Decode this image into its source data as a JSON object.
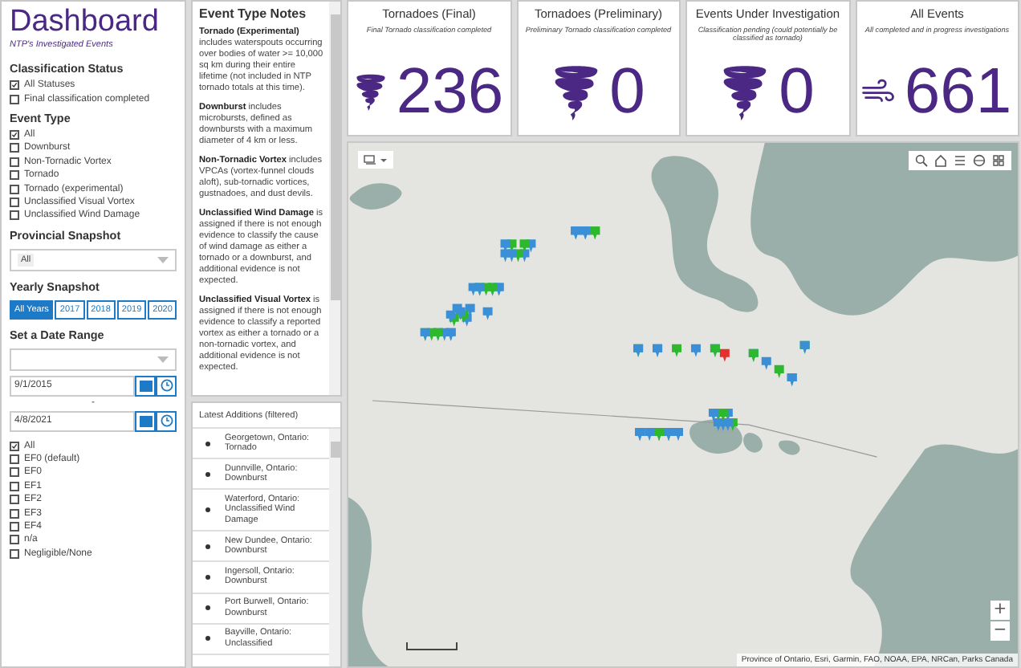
{
  "header": {
    "title": "Dashboard",
    "subtitle": "NTP's Investigated Events"
  },
  "classification_status": {
    "heading": "Classification Status",
    "options": [
      {
        "label": "All Statuses",
        "checked": true
      },
      {
        "label": "Final classification completed",
        "checked": false
      }
    ]
  },
  "event_type": {
    "heading": "Event Type",
    "options": [
      {
        "label": "All",
        "checked": true
      },
      {
        "label": "Downburst",
        "checked": false
      },
      {
        "label": "Non-Tornadic Vortex",
        "checked": false
      },
      {
        "label": "Tornado",
        "checked": false
      },
      {
        "label": "Tornado (experimental)",
        "checked": false
      },
      {
        "label": "Unclassified Visual Vortex",
        "checked": false
      },
      {
        "label": "Unclassified Wind Damage",
        "checked": false
      }
    ]
  },
  "provincial_snapshot": {
    "heading": "Provincial Snapshot",
    "value": "All"
  },
  "yearly_snapshot": {
    "heading": "Yearly Snapshot",
    "buttons": [
      {
        "label": "All Years",
        "selected": true
      },
      {
        "label": "2017",
        "selected": false
      },
      {
        "label": "2018",
        "selected": false
      },
      {
        "label": "2019",
        "selected": false
      },
      {
        "label": "2020",
        "selected": false
      }
    ]
  },
  "date_range": {
    "heading": "Set a Date Range",
    "start": "9/1/2015",
    "separator": "-",
    "end": "4/8/2021"
  },
  "intensity": {
    "options": [
      {
        "label": "All",
        "checked": true
      },
      {
        "label": "EF0 (default)",
        "checked": false
      },
      {
        "label": "EF0",
        "checked": false
      },
      {
        "label": "EF1",
        "checked": false
      },
      {
        "label": "EF2",
        "checked": false
      },
      {
        "label": "EF3",
        "checked": false
      },
      {
        "label": "EF4",
        "checked": false
      },
      {
        "label": "n/a",
        "checked": false
      },
      {
        "label": "Negligible/None",
        "checked": false
      }
    ]
  },
  "notes": {
    "heading": "Event Type Notes",
    "items": [
      "**Tornado (Experimental)** includes waterspouts occurring over bodies of water >= 10,000 sq km during their entire lifetime (not included in NTP tornado totals at this time).",
      "**Downburst** includes microbursts, defined as downbursts with a maximum diameter of 4 km or less.",
      "**Non-Tornadic Vortex** includes VPCAs (vortex-funnel clouds aloft), sub-tornadic vortices, gustnadoes, and dust devils.",
      "**Unclassified Wind Damage** is assigned if there is not enough evidence to classify the cause of wind damage as either a tornado or a downburst, and additional evidence is not expected.",
      "**Unclassified Visual Vortex** is assigned if there is not enough evidence to classify a reported vortex as either a tornado or a non-tornadic vortex, and additional evidence is not expected."
    ]
  },
  "latest_additions": {
    "heading": "Latest Additions (filtered)",
    "items": [
      "Georgetown, Ontario: Tornado",
      "Dunnville, Ontario: Downburst",
      "Waterford, Ontario: Unclassified Wind Damage",
      "New Dundee, Ontario: Downburst",
      "Ingersoll, Ontario: Downburst",
      "Port Burwell, Ontario: Downburst",
      "Bayville, Ontario: Unclassified"
    ]
  },
  "stats": [
    {
      "title": "Tornadoes (Final)",
      "subtitle": "Final Tornado classification completed",
      "value": "236",
      "kind": "tornado"
    },
    {
      "title": "Tornadoes (Preliminary)",
      "subtitle": "Preliminary Tornado classification completed",
      "value": "0",
      "kind": "tornado"
    },
    {
      "title": "Events Under Investigation",
      "subtitle": "Classification pending (could potentially be classified as tornado)",
      "value": "0",
      "kind": "tornado"
    },
    {
      "title": "All Events",
      "subtitle": "All completed and in progress investigations",
      "value": "661",
      "kind": "wind"
    }
  ],
  "map": {
    "zoom_in": "+",
    "zoom_out": "−",
    "attribution": "Province of Ontario, Esri, Garmin, FAO, NOAA, EPA, NRCan, Parks Canada"
  }
}
